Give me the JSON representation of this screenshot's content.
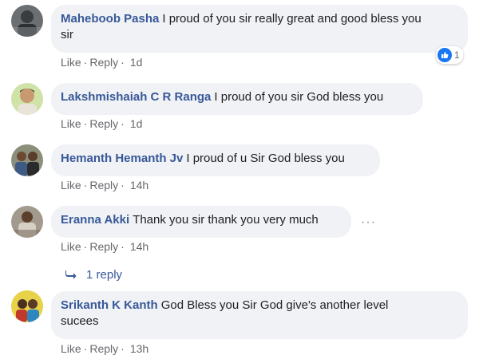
{
  "comments": [
    {
      "author": "Maheboob Pasha",
      "text_line1": "I proud of you sir really great and good bless you",
      "text_line2": "sir",
      "like": "Like",
      "reply": "Reply",
      "time": "1d",
      "reaction_count": "1"
    },
    {
      "author": "Lakshmishaiah C R Ranga",
      "text": "I proud of you sir God bless you",
      "like": "Like",
      "reply": "Reply",
      "time": "1d"
    },
    {
      "author": "Hemanth Hemanth Jv",
      "text": "I proud of u Sir God bless you",
      "like": "Like",
      "reply": "Reply",
      "time": "14h"
    },
    {
      "author": "Eranna Akki",
      "text": "Thank you sir thank you very much",
      "like": "Like",
      "reply": "Reply",
      "time": "14h",
      "more": "···",
      "replies_label": "1 reply"
    },
    {
      "author": "Srikanth K Kanth",
      "text_line1": "God Bless you Sir God give's another level",
      "text_line2": "sucees",
      "like": "Like",
      "reply": "Reply",
      "time": "13h"
    }
  ],
  "separator": "·",
  "colors": {
    "author": "#385898",
    "bubble": "#f0f2f5",
    "meta": "#65676b",
    "like_blue": "#1877f2"
  }
}
